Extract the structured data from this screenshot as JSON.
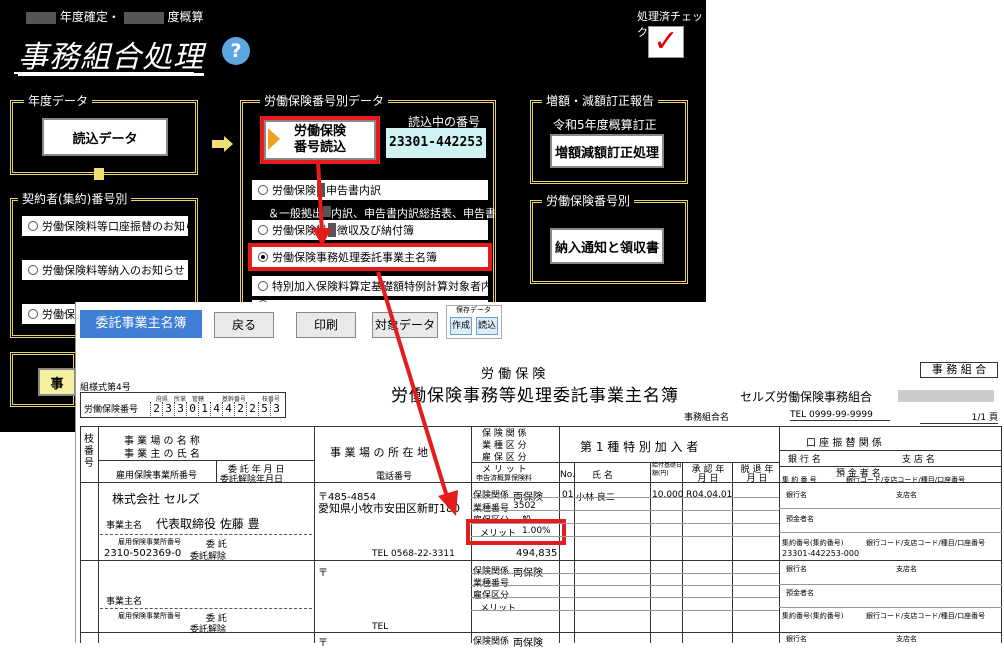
{
  "menu": {
    "header": {
      "left_label": "年度確定・",
      "mid_label": "度概算",
      "right_label": "処理済チェック",
      "check_mark": "✓"
    },
    "title": "事務組合処理",
    "help_label": "?",
    "year_group": {
      "title": "年度データ",
      "button": "読込データ"
    },
    "contract_group": {
      "title": "契約者(集約)番号別",
      "items": [
        "労働保険料等口座振替のお知らせ",
        "労働保険料等納入のお知らせ",
        "労働保"
      ]
    },
    "labor_group": {
      "title": "労働保険番号別データ",
      "read_button": [
        "労働保険",
        "番号読込"
      ],
      "current_label": "読込中の番号",
      "current_value": "23301-442253",
      "items": [
        {
          "label": "労働保険",
          "tail": "申告書内訳",
          "selected": false
        },
        {
          "label": "＆一般拠出",
          "tail": "内訳、申告書内訳総括表、申告書",
          "selected": false,
          "sub": true
        },
        {
          "label": "労働保険料",
          "tail": "徴収及び納付簿",
          "selected": false
        },
        {
          "label": "労働保険事務処理委託事業主名簿",
          "tail": "",
          "selected": true
        },
        {
          "label": "特別加入保険料算定基礎額特例計算対象者内訳",
          "tail": "",
          "selected": false
        },
        {
          "label": "",
          "tail": "",
          "selected": false
        }
      ]
    },
    "correction_group": {
      "title": "増額・減額訂正報告",
      "note": "令和5年度概算訂正",
      "button": "増額減額訂正処理"
    },
    "number_group": {
      "title": "労働保険番号別",
      "button": "納入通知と領収書"
    },
    "side_button": "事"
  },
  "doc": {
    "toolbar": {
      "title": "委託事業主名簿",
      "back": "戻る",
      "print": "印刷",
      "target": "対象データ",
      "save_group_label": "保存データ",
      "save_create": "作成",
      "save_load": "読込"
    },
    "form_no": "組様式第4号",
    "labor_no_label": "労働保険番号",
    "labor_no_heads": [
      "府県",
      "所掌",
      "管轄",
      "基幹番号",
      "枝番号"
    ],
    "labor_no_digits": [
      "2",
      "3",
      "3",
      "0",
      "1",
      "4",
      "4",
      "2",
      "2",
      "5",
      "3"
    ],
    "title_top": "労 働 保 険",
    "title_main": "労働保険事務等処理委託事業主名簿",
    "kumiai_box": "事 務 組 合",
    "kumiai_name": "セルズ労働保険事務組合",
    "kumiai_no_label": "事務組合名",
    "tel": "TEL 0999-99-9999",
    "page": "1/1 頁",
    "headers": {
      "branch": "枝番号",
      "jigyosho": "事 業 場 の 名 称",
      "jigyonushi": "事 業 主 の 氏 名",
      "koyo_no": "雇用保険事業所番号",
      "itaku_date": "委 託 年 月 日",
      "kaijo_date": "委託解除年月日",
      "location": "事 業 場 の 所 在 地",
      "phone": "電話番号",
      "kankei": "保 険 関 係",
      "gyoshu": "業 種 区 分",
      "koyo_kubun": "雇 保 区 分",
      "merit": "メ リ ッ ト",
      "shinkoku": "申告済概算保険料",
      "tokubetsu": "第 1 種 特 別 加 入 者",
      "no": "No.",
      "name": "氏 名",
      "kyufu": "給付基礎日額(円)",
      "shonin": "承 認 年 月 日",
      "dattai": "脱 退 年 月 日",
      "koza": "口 座 振 替 関 係",
      "bank": "銀 行 名",
      "branch_name": "支 店 名",
      "yokin": "預 金 者 名",
      "shugaku": "集 約 番 号",
      "codes": "銀行コード/支店コード/種目/口座番号"
    },
    "row1": {
      "company": "株式会社 セルズ",
      "owner_label": "事業主名",
      "owner": "代表取締役 佐藤 豊",
      "koyo_label": "雇用保険事業所番号",
      "itaku_label": "委 託",
      "koyo_no": "2310-502369-0",
      "kaijo_label": "委託解除",
      "zip": "〒485-4854",
      "address": "愛知県小牧市安田区新町180",
      "tel": "TEL 0568-22-3311",
      "kankei_label": "保険関係",
      "kankei_val": "両保険",
      "gyoshu_label": "業種番号",
      "gyoshu_val": "3502",
      "koyo_kubun_label": "雇保区分",
      "koyo_kubun_val": "一般",
      "merit_label": "メリット",
      "merit_val": "1.00%",
      "premium": "494,835",
      "member_no": "01",
      "member_name": "小林 良二",
      "member_daily": "10,000",
      "member_date": "R04.04.01",
      "bank_label": "銀行名",
      "branch_label": "支店名",
      "holder_label": "預金者名",
      "shugaku_label": "集約番号(集約番号)",
      "codes_label": "銀行コード/支店コード/種目/口座番号",
      "shugaku_val": "23301-442253-000"
    },
    "row2": {
      "zip": "〒",
      "owner_label": "事業主名",
      "koyo_label": "雇用保険事業所番号",
      "itaku_label": "委 託",
      "kaijo_label": "委託解除",
      "tel": "TEL",
      "kankei_label": "保険関係",
      "kankei_val": "両保険",
      "gyoshu_label": "業種番号",
      "koyo_kubun_label": "雇保区分",
      "merit_label": "メリット",
      "bank_label": "銀行名",
      "branch_label": "支店名",
      "holder_label": "預金者名",
      "shugaku_label": "集約番号(集約番号)",
      "codes_label": "銀行コード/支店コード/種目/口座番号"
    },
    "row3": {
      "zip": "〒",
      "kankei_label": "保険関係",
      "kankei_val": "両保険",
      "bank_label": "銀行名",
      "branch_label": "支店名"
    }
  }
}
